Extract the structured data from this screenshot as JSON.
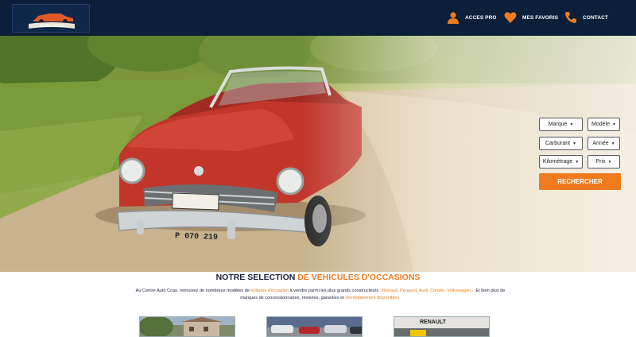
{
  "header": {
    "logo_text": "Auto Ccas",
    "nav": [
      {
        "label": "ACCES PRO",
        "icon": "user-icon"
      },
      {
        "label": "MES FAVORIS",
        "icon": "heart-icon"
      },
      {
        "label": "CONTACT",
        "icon": "phone-icon"
      }
    ]
  },
  "hero": {
    "plate": "P 070 219"
  },
  "search": {
    "filters": [
      "Marque",
      "Modèle",
      "Carburant",
      "Année",
      "Kilométrage",
      "Prix"
    ],
    "button_label": "RECHERCHER"
  },
  "selection": {
    "title_part1": "NOTRE SELECTION ",
    "title_part2": "DE VEHICULES D'OCCASIONS",
    "desc": {
      "t1": "Au Centre Auto Ccas, retrouvez de nombreux modèles de ",
      "h1": "voitures d'occasion",
      "t2": " à vendre parmi les plus grands constructeurs : ",
      "h2": "Renault, Peugeot, Audi, Citroën, Volkswagen...",
      "t3": " Et bien plus de marques de concessionnaires, révisées, garanties et ",
      "h3": "immédiatement disponibles."
    },
    "thumb_label": "RENAULT"
  },
  "colors": {
    "header_bg": "#0b1f3a",
    "accent": "#f07b1e"
  }
}
